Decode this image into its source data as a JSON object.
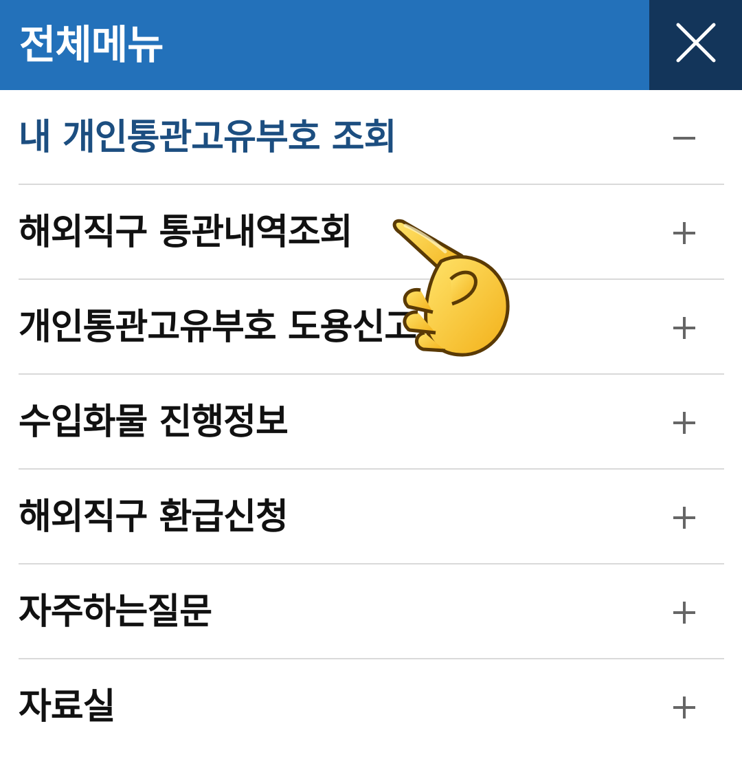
{
  "header": {
    "title": "전체메뉴",
    "close_icon": "close-icon",
    "background_color": "#2371ba",
    "close_background_color": "#13355a"
  },
  "menu": {
    "items": [
      {
        "label": "내 개인통관고유부호 조회",
        "toggle": "minus",
        "expanded": true
      },
      {
        "label": "해외직구 통관내역조회",
        "toggle": "plus",
        "expanded": false
      },
      {
        "label": "개인통관고유부호 도용신고",
        "toggle": "plus",
        "expanded": false
      },
      {
        "label": "수입화물 진행정보",
        "toggle": "plus",
        "expanded": false
      },
      {
        "label": "해외직구 환급신청",
        "toggle": "plus",
        "expanded": false
      },
      {
        "label": "자주하는질문",
        "toggle": "plus",
        "expanded": false
      },
      {
        "label": "자료실",
        "toggle": "plus",
        "expanded": false
      }
    ]
  },
  "overlay": {
    "icon": "pointing-hand-emoji"
  }
}
